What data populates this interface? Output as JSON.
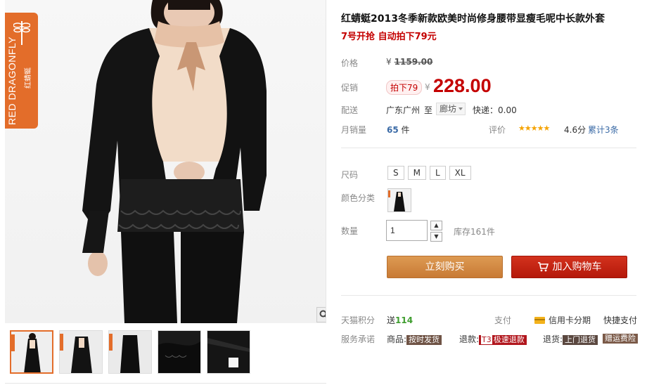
{
  "product": {
    "title": "红蜻蜓2013冬季新款欧美时尚修身腰带显瘦毛呢中长款外套",
    "promo_line": "7号开抢 自动拍下79元"
  },
  "brand": {
    "name_en": "RED DRAGONFLY",
    "name_cn": "红蜻蜓",
    "color": "#e36d2a"
  },
  "price": {
    "label": "价格",
    "currency": "¥",
    "original": "1159.00",
    "promo_label": "促销",
    "promo_tag": "拍下79",
    "promo_value": "228.00",
    "price_color": "#c40000"
  },
  "shipping": {
    "label": "配送",
    "from": "广东广州",
    "to_word": "至",
    "destination": "廊坊",
    "fee": "快递：0.00"
  },
  "sales": {
    "label": "月销量",
    "count": "65",
    "unit": "件",
    "rating_label": "评价",
    "stars": "★★★★★",
    "score": "4.6分",
    "review_count": "累计3条"
  },
  "size": {
    "label": "尺码",
    "options": [
      "S",
      "M",
      "L",
      "XL"
    ]
  },
  "color": {
    "label": "颜色分类"
  },
  "quantity": {
    "label": "数量",
    "value": "1",
    "up": "▲",
    "down": "▼",
    "stock": "库存161件"
  },
  "actions": {
    "buy_now": "立刻购买",
    "add_to_cart": "加入购物车",
    "buy_color": "#d08640",
    "cart_color": "#c4220f"
  },
  "points": {
    "label": "天猫积分",
    "prefix": "送",
    "value": "114",
    "pay_label": "支付",
    "credit": "信用卡分期",
    "quick": "快捷支付"
  },
  "service": {
    "label": "服务承诺",
    "goods_label": "商品:",
    "goods_badge": "按时发货",
    "refund_label": "退款:",
    "refund_t3": "T3",
    "refund_badge": "极速退款",
    "return_label": "退货:",
    "return_badge": "上门退货",
    "freight_badge": "赠运费险"
  },
  "gallery": {
    "zoom_icon": "magnifier-icon",
    "thumb_count": 5
  }
}
